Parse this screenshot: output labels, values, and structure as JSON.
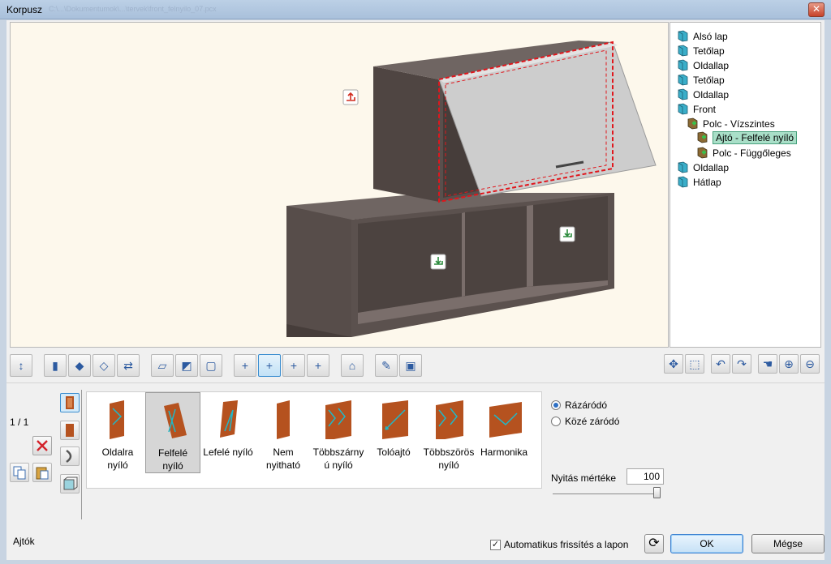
{
  "window": {
    "title": "Korpusz",
    "path_hint": "C:\\...\\Dokumentumok\\...\\tervek\\front_felnyilo_07.pcx",
    "close_label": "✕"
  },
  "tree": [
    {
      "label": "Alsó lap",
      "level": 0,
      "icon": "panel-icon"
    },
    {
      "label": "Tetőlap",
      "level": 0,
      "icon": "panel-icon"
    },
    {
      "label": "Oldallap",
      "level": 0,
      "icon": "panel-icon"
    },
    {
      "label": "Tetőlap",
      "level": 0,
      "icon": "panel-icon"
    },
    {
      "label": "Oldallap",
      "level": 0,
      "icon": "panel-icon"
    },
    {
      "label": "Front",
      "level": 0,
      "icon": "panel-icon"
    },
    {
      "label": "Polc - Vízszintes",
      "level": 1,
      "icon": "shelf-icon"
    },
    {
      "label": "Ajtó - Felfelé nyíló",
      "level": 2,
      "icon": "door-icon",
      "selected": true
    },
    {
      "label": "Polc - Függőleges",
      "level": 2,
      "icon": "shelf-icon"
    },
    {
      "label": "Oldallap",
      "level": 0,
      "icon": "panel-icon"
    },
    {
      "label": "Hátlap",
      "level": 0,
      "icon": "panel-icon"
    }
  ],
  "toolbar_left": [
    {
      "name": "dimensions-icon",
      "glyph": "↕",
      "group": 0
    },
    {
      "name": "wood-panel-icon",
      "glyph": "▮",
      "group": 1
    },
    {
      "name": "blue-panel-icon",
      "glyph": "◆",
      "group": 1
    },
    {
      "name": "glass-panel-icon",
      "glyph": "◇",
      "group": 1
    },
    {
      "name": "material-swap-icon",
      "glyph": "⇄",
      "group": 1
    },
    {
      "name": "box-outline-icon",
      "glyph": "▱",
      "group": 2
    },
    {
      "name": "box-blue-icon",
      "glyph": "◩",
      "group": 2
    },
    {
      "name": "box-gray-icon",
      "glyph": "▢",
      "group": 2
    },
    {
      "name": "add-panel-icon",
      "glyph": "+",
      "group": 3
    },
    {
      "name": "add-door-icon",
      "glyph": "+",
      "group": 3,
      "active": true
    },
    {
      "name": "add-shelf-icon",
      "glyph": "+",
      "group": 3
    },
    {
      "name": "add-drawer-icon",
      "glyph": "+",
      "group": 3
    },
    {
      "name": "accessory-icon",
      "glyph": "⌂",
      "group": 4
    },
    {
      "name": "edit-icon",
      "glyph": "✎",
      "group": 5
    },
    {
      "name": "save-icon",
      "glyph": "▣",
      "group": 5
    }
  ],
  "toolbar_right": [
    {
      "name": "move-icon",
      "glyph": "✥"
    },
    {
      "name": "box-3d-icon",
      "glyph": "⬚"
    },
    {
      "name": "undo-icon",
      "glyph": "↶"
    },
    {
      "name": "redo-icon",
      "glyph": "↷"
    },
    {
      "name": "pan-hand-icon",
      "glyph": "☚"
    },
    {
      "name": "zoom-in-icon",
      "glyph": "⊕"
    },
    {
      "name": "zoom-out-icon",
      "glyph": "⊖"
    }
  ],
  "page_counter": "1 / 1",
  "door_types": [
    {
      "label": "Oldalra nyíló",
      "lines": [
        "Oldalra",
        "nyíló"
      ],
      "icon": "side-opening-door-icon"
    },
    {
      "label": "Felfelé nyíló",
      "lines": [
        "Felfelé",
        "nyíló"
      ],
      "icon": "upward-opening-door-icon",
      "selected": true
    },
    {
      "label": "Lefelé nyíló",
      "lines": [
        "Lefelé nyíló"
      ],
      "icon": "downward-opening-door-icon"
    },
    {
      "label": "Nem nyitható",
      "lines": [
        "Nem",
        "nyitható"
      ],
      "icon": "fixed-door-icon"
    },
    {
      "label": "Többszárnyú nyíló",
      "lines": [
        "Többszárny",
        "ú nyíló"
      ],
      "icon": "multi-leaf-door-icon"
    },
    {
      "label": "Tolóajtó",
      "lines": [
        "Tolóajtó"
      ],
      "icon": "sliding-door-icon"
    },
    {
      "label": "Többszörös nyíló",
      "lines": [
        "Többszörös",
        "nyíló"
      ],
      "icon": "multiple-opening-door-icon"
    },
    {
      "label": "Harmonika",
      "lines": [
        "Harmonika"
      ],
      "icon": "folding-door-icon"
    }
  ],
  "closing": {
    "options": [
      {
        "label": "Rázáródó",
        "checked": true
      },
      {
        "label": "Közé záródó",
        "checked": false
      }
    ]
  },
  "opening": {
    "label": "Nyitás mértéke",
    "value": "100",
    "level": 1.0
  },
  "status": {
    "section_label": "Ajtók"
  },
  "auto_refresh": {
    "label": "Automatikus frissítés a lapon",
    "checked": true,
    "mark": "✓"
  },
  "buttons": {
    "refresh_glyph": "⟳",
    "ok_label": "OK",
    "cancel_label": "Mégse"
  },
  "colors": {
    "wood": "#5d5350",
    "wood_dark": "#463d3a",
    "wood_light": "#746967",
    "door_panel": "#cfcfcf",
    "selection": "#e0161c",
    "viewport_bg": "#fdf8ec",
    "door_icon_orange": "#b5521f",
    "door_icon_cyan": "#1fb8c8"
  }
}
